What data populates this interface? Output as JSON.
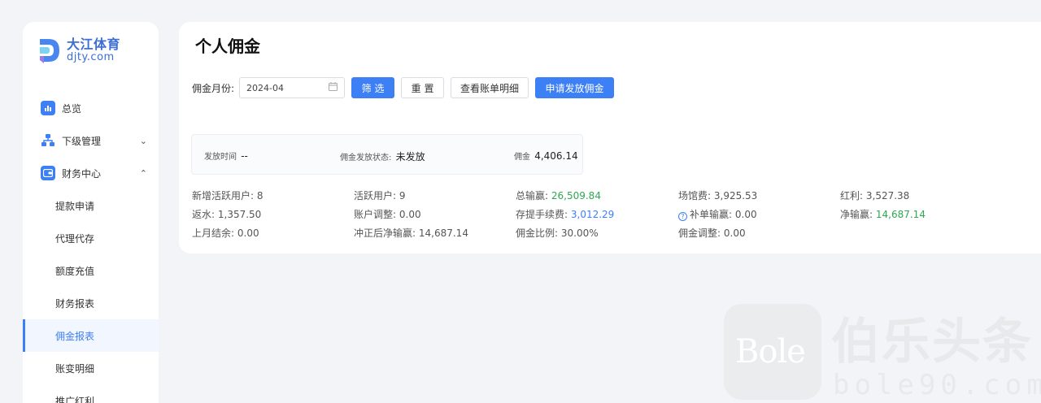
{
  "brand": {
    "name_cn": "大江体育",
    "name_en": "djty.com"
  },
  "sidebar": {
    "items": [
      {
        "label": "总览",
        "icon": "bar-chart-icon",
        "caret": ""
      },
      {
        "label": "下级管理",
        "icon": "org-tree-icon",
        "caret": "⌄"
      },
      {
        "label": "财务中心",
        "icon": "wallet-icon",
        "caret": "⌃"
      }
    ],
    "sub_items": [
      {
        "label": "提款申请"
      },
      {
        "label": "代理代存"
      },
      {
        "label": "额度充值"
      },
      {
        "label": "财务报表"
      },
      {
        "label": "佣金报表"
      },
      {
        "label": "账变明细"
      },
      {
        "label": "推广红利"
      }
    ]
  },
  "main": {
    "title": "个人佣金",
    "filter": {
      "month_label": "佣金月份:",
      "month_value": "2024-04",
      "filter_btn": "筛 选",
      "reset_btn": "重 置",
      "detail_btn": "查看账单明细",
      "apply_btn": "申请发放佣金"
    },
    "status": {
      "time_label": "发放时间",
      "time_value": "--",
      "state_label": "佣金发放状态:",
      "state_value": "未发放",
      "amount_label": "佣金",
      "amount_value": "4,406.14"
    },
    "stats": [
      {
        "label": "新增活跃用户:",
        "value": "8",
        "color": ""
      },
      {
        "label": "活跃用户:",
        "value": "9",
        "color": ""
      },
      {
        "label": "总输赢:",
        "value": "26,509.84",
        "color": "green"
      },
      {
        "label": "场馆费:",
        "value": "3,925.53",
        "color": ""
      },
      {
        "label": "红利:",
        "value": "3,527.38",
        "color": ""
      },
      {
        "label": "返水:",
        "value": "1,357.50",
        "color": ""
      },
      {
        "label": "账户调整:",
        "value": "0.00",
        "color": ""
      },
      {
        "label": "存提手续费:",
        "value": "3,012.29",
        "color": "blue"
      },
      {
        "label": "补单输赢:",
        "value": "0.00",
        "color": ""
      },
      {
        "label": "净输赢:",
        "value": "14,687.14",
        "color": "green"
      },
      {
        "label": "上月结余:",
        "value": "0.00",
        "color": ""
      },
      {
        "label": "冲正后净输赢:",
        "value": "14,687.14",
        "color": ""
      },
      {
        "label": "佣金比例:",
        "value": "30.00%",
        "color": ""
      },
      {
        "label": "佣金调整:",
        "value": "0.00",
        "color": ""
      }
    ]
  },
  "watermark": {
    "badge": "Bole",
    "cn": "伯乐头条",
    "en": "bole90.com"
  },
  "colors": {
    "accent": "#3d7ff5",
    "positive": "#2fa84f",
    "background": "#f3f4f7"
  }
}
